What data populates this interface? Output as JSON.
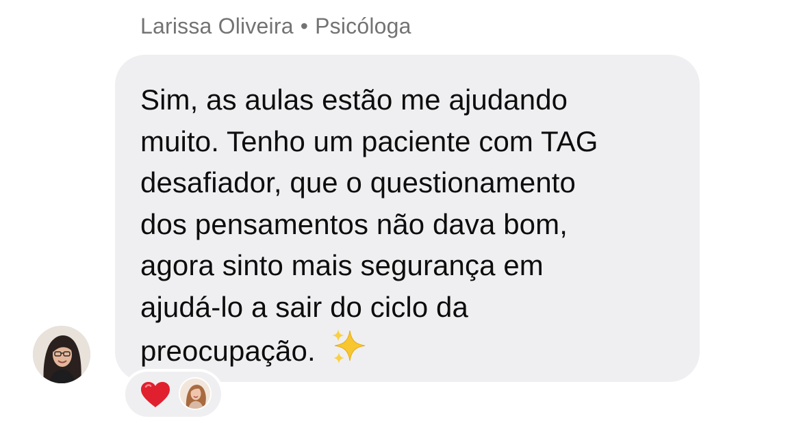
{
  "message": {
    "sender_name": "Larissa Oliveira",
    "separator": "•",
    "sender_role": "Psicóloga",
    "lines": [
      "Sim, as aulas estão me ajudando",
      "muito. Tenho um paciente com TAG",
      "desafiador, que o questionamento",
      "dos pensamentos não dava bom,",
      "agora sinto mais segurança em",
      "ajudá-lo a sair do ciclo da",
      "preocupação."
    ],
    "emoji": "sparkles-icon"
  },
  "reactions": {
    "emoji": "heart-icon",
    "reactor": "reactor-avatar"
  },
  "colors": {
    "bubble_bg": "#efeff1",
    "text": "#0d0d0d",
    "sender_text": "#737373",
    "heart": "#e0202f",
    "sparkle": "#f7c630"
  }
}
